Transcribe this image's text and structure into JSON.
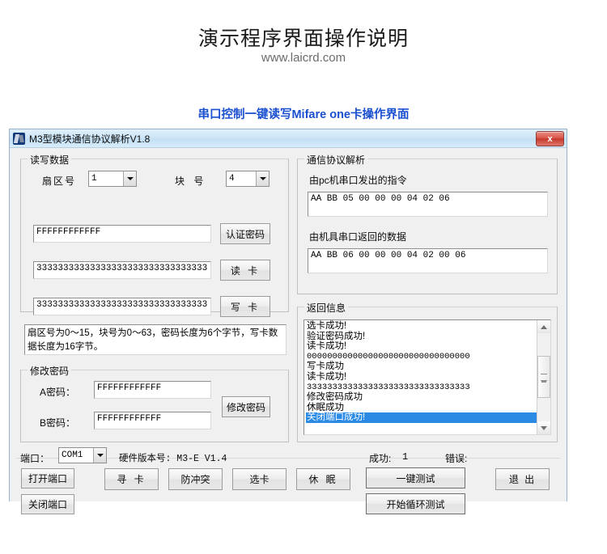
{
  "page": {
    "title": "演示程序界面操作说明",
    "url": "www.laicrd.com",
    "section_caption": "串口控制一键读写Mifare one卡操作界面",
    "accent_color": "#1a4fd0"
  },
  "window": {
    "title": "M3型模块通信协议解析V1.8",
    "close_label": "x",
    "icon": "app-icon"
  },
  "read_write_group": {
    "legend": "读写数据",
    "sector_label": "扇区号",
    "sector_value": "1",
    "block_label": "块 号",
    "block_value": "4",
    "key_value": "FFFFFFFFFFFF",
    "key_button": "认证密码",
    "read_value": "33333333333333333333333333333333",
    "read_button": "读 卡",
    "write_value": "33333333333333333333333333333333",
    "write_button": "写 卡",
    "hint": "扇区号为0～15，块号为0～63，密码长度为6个字节，写卡数据长度为16字节。"
  },
  "modify_password_group": {
    "legend": "修改密码",
    "a_label": "A密码：",
    "a_value": "FFFFFFFFFFFF",
    "b_label": "B密码：",
    "b_value": "FFFFFFFFFFFF",
    "button": "修改密码"
  },
  "protocol_group": {
    "legend": "通信协议解析",
    "sent_label": "由pc机串口发出的指令",
    "sent_value": "AA BB 05 00 00 00 04 02 06",
    "recv_label": "由机具串口返回的数据",
    "recv_value": "AA BB 06 00 00 00 04 02 00 06"
  },
  "return_info_group": {
    "legend": "返回信息",
    "lines": [
      {
        "text": "选卡成功!",
        "mono": false,
        "selected": false
      },
      {
        "text": "验证密码成功!",
        "mono": false,
        "selected": false
      },
      {
        "text": "读卡成功!",
        "mono": false,
        "selected": false
      },
      {
        "text": "00000000000000000000000000000000",
        "mono": true,
        "selected": false
      },
      {
        "text": "写卡成功",
        "mono": false,
        "selected": false
      },
      {
        "text": "读卡成功!",
        "mono": false,
        "selected": false
      },
      {
        "text": "33333333333333333333333333333333",
        "mono": true,
        "selected": false
      },
      {
        "text": "修改密码成功",
        "mono": false,
        "selected": false
      },
      {
        "text": "休眠成功",
        "mono": false,
        "selected": false
      },
      {
        "text": "关闭端口成功!",
        "mono": false,
        "selected": true
      }
    ],
    "selection_color": "#2a8ae4"
  },
  "status_bar": {
    "port_label": "端口：",
    "port_value": "COM1",
    "hw_version": "硬件版本号: M3-E V1.4",
    "success_label": "成功:",
    "success_value": "1",
    "error_label": "错误:",
    "error_value": ""
  },
  "action_buttons": {
    "open_port": "打开端口",
    "close_port": "关闭端口",
    "find_card": "寻 卡",
    "anticollision": "防冲突",
    "select_card": "选卡",
    "sleep": "休 眠",
    "one_key_test": "一键测试",
    "loop_test": "开始循环测试",
    "exit": "退 出"
  }
}
